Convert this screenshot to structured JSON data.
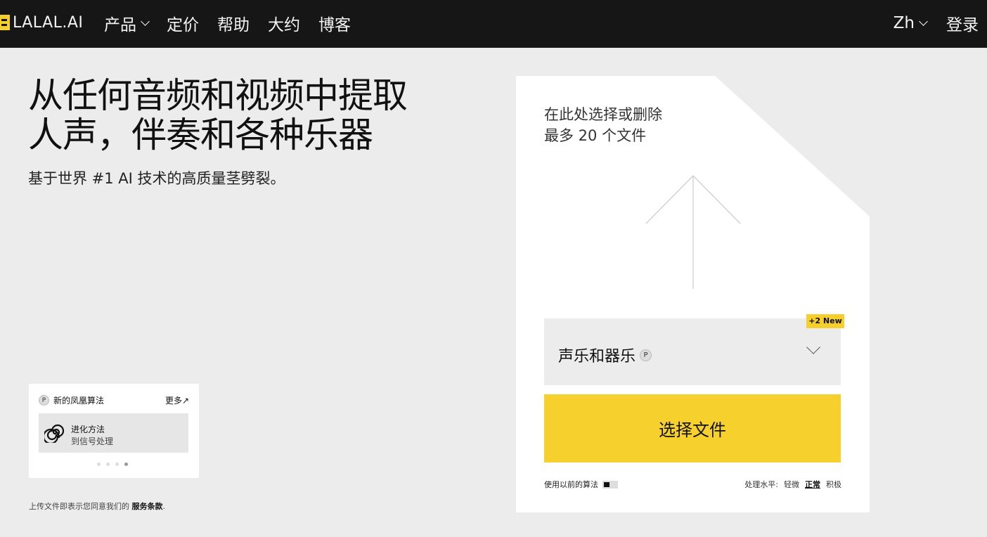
{
  "nav": {
    "logo_text": "LALAL.AI",
    "links": [
      {
        "label": "产品",
        "dropdown": true
      },
      {
        "label": "定价"
      },
      {
        "label": "帮助"
      },
      {
        "label": "大约"
      },
      {
        "label": "博客"
      }
    ],
    "language": "Zh",
    "login": "登录"
  },
  "hero": {
    "title_line1": "从任何音频和视频中提取",
    "title_line2": "人声，伴奏和各种乐器",
    "subtitle": "基于世界 #1 AI 技术的高质量茎劈裂。"
  },
  "mini_card": {
    "badge": "P",
    "title": "新的凤凰算法",
    "more": "更多↗",
    "item_title": "进化方法",
    "item_subtitle": "到信号处理",
    "slides": 4,
    "active_slide": 4
  },
  "terms": {
    "prefix": "上传文件即表示您同意我们的 ",
    "link": "服务条款",
    "suffix": "."
  },
  "upload": {
    "hint_line1": "在此处选择或删除",
    "hint_line2": "最多 20 个文件",
    "new_badge": "+2 New",
    "stem_select": "声乐和器乐",
    "stem_badge": "P",
    "choose_button": "选择文件",
    "prev_algo_label": "使用以前的算法",
    "level_label": "处理水平:",
    "level_options": [
      "轻微",
      "正常",
      "积极"
    ],
    "level_selected": "正常"
  },
  "colors": {
    "nav_bg": "#161616",
    "accent": "#f6d12e",
    "page_bg": "#ececec"
  }
}
